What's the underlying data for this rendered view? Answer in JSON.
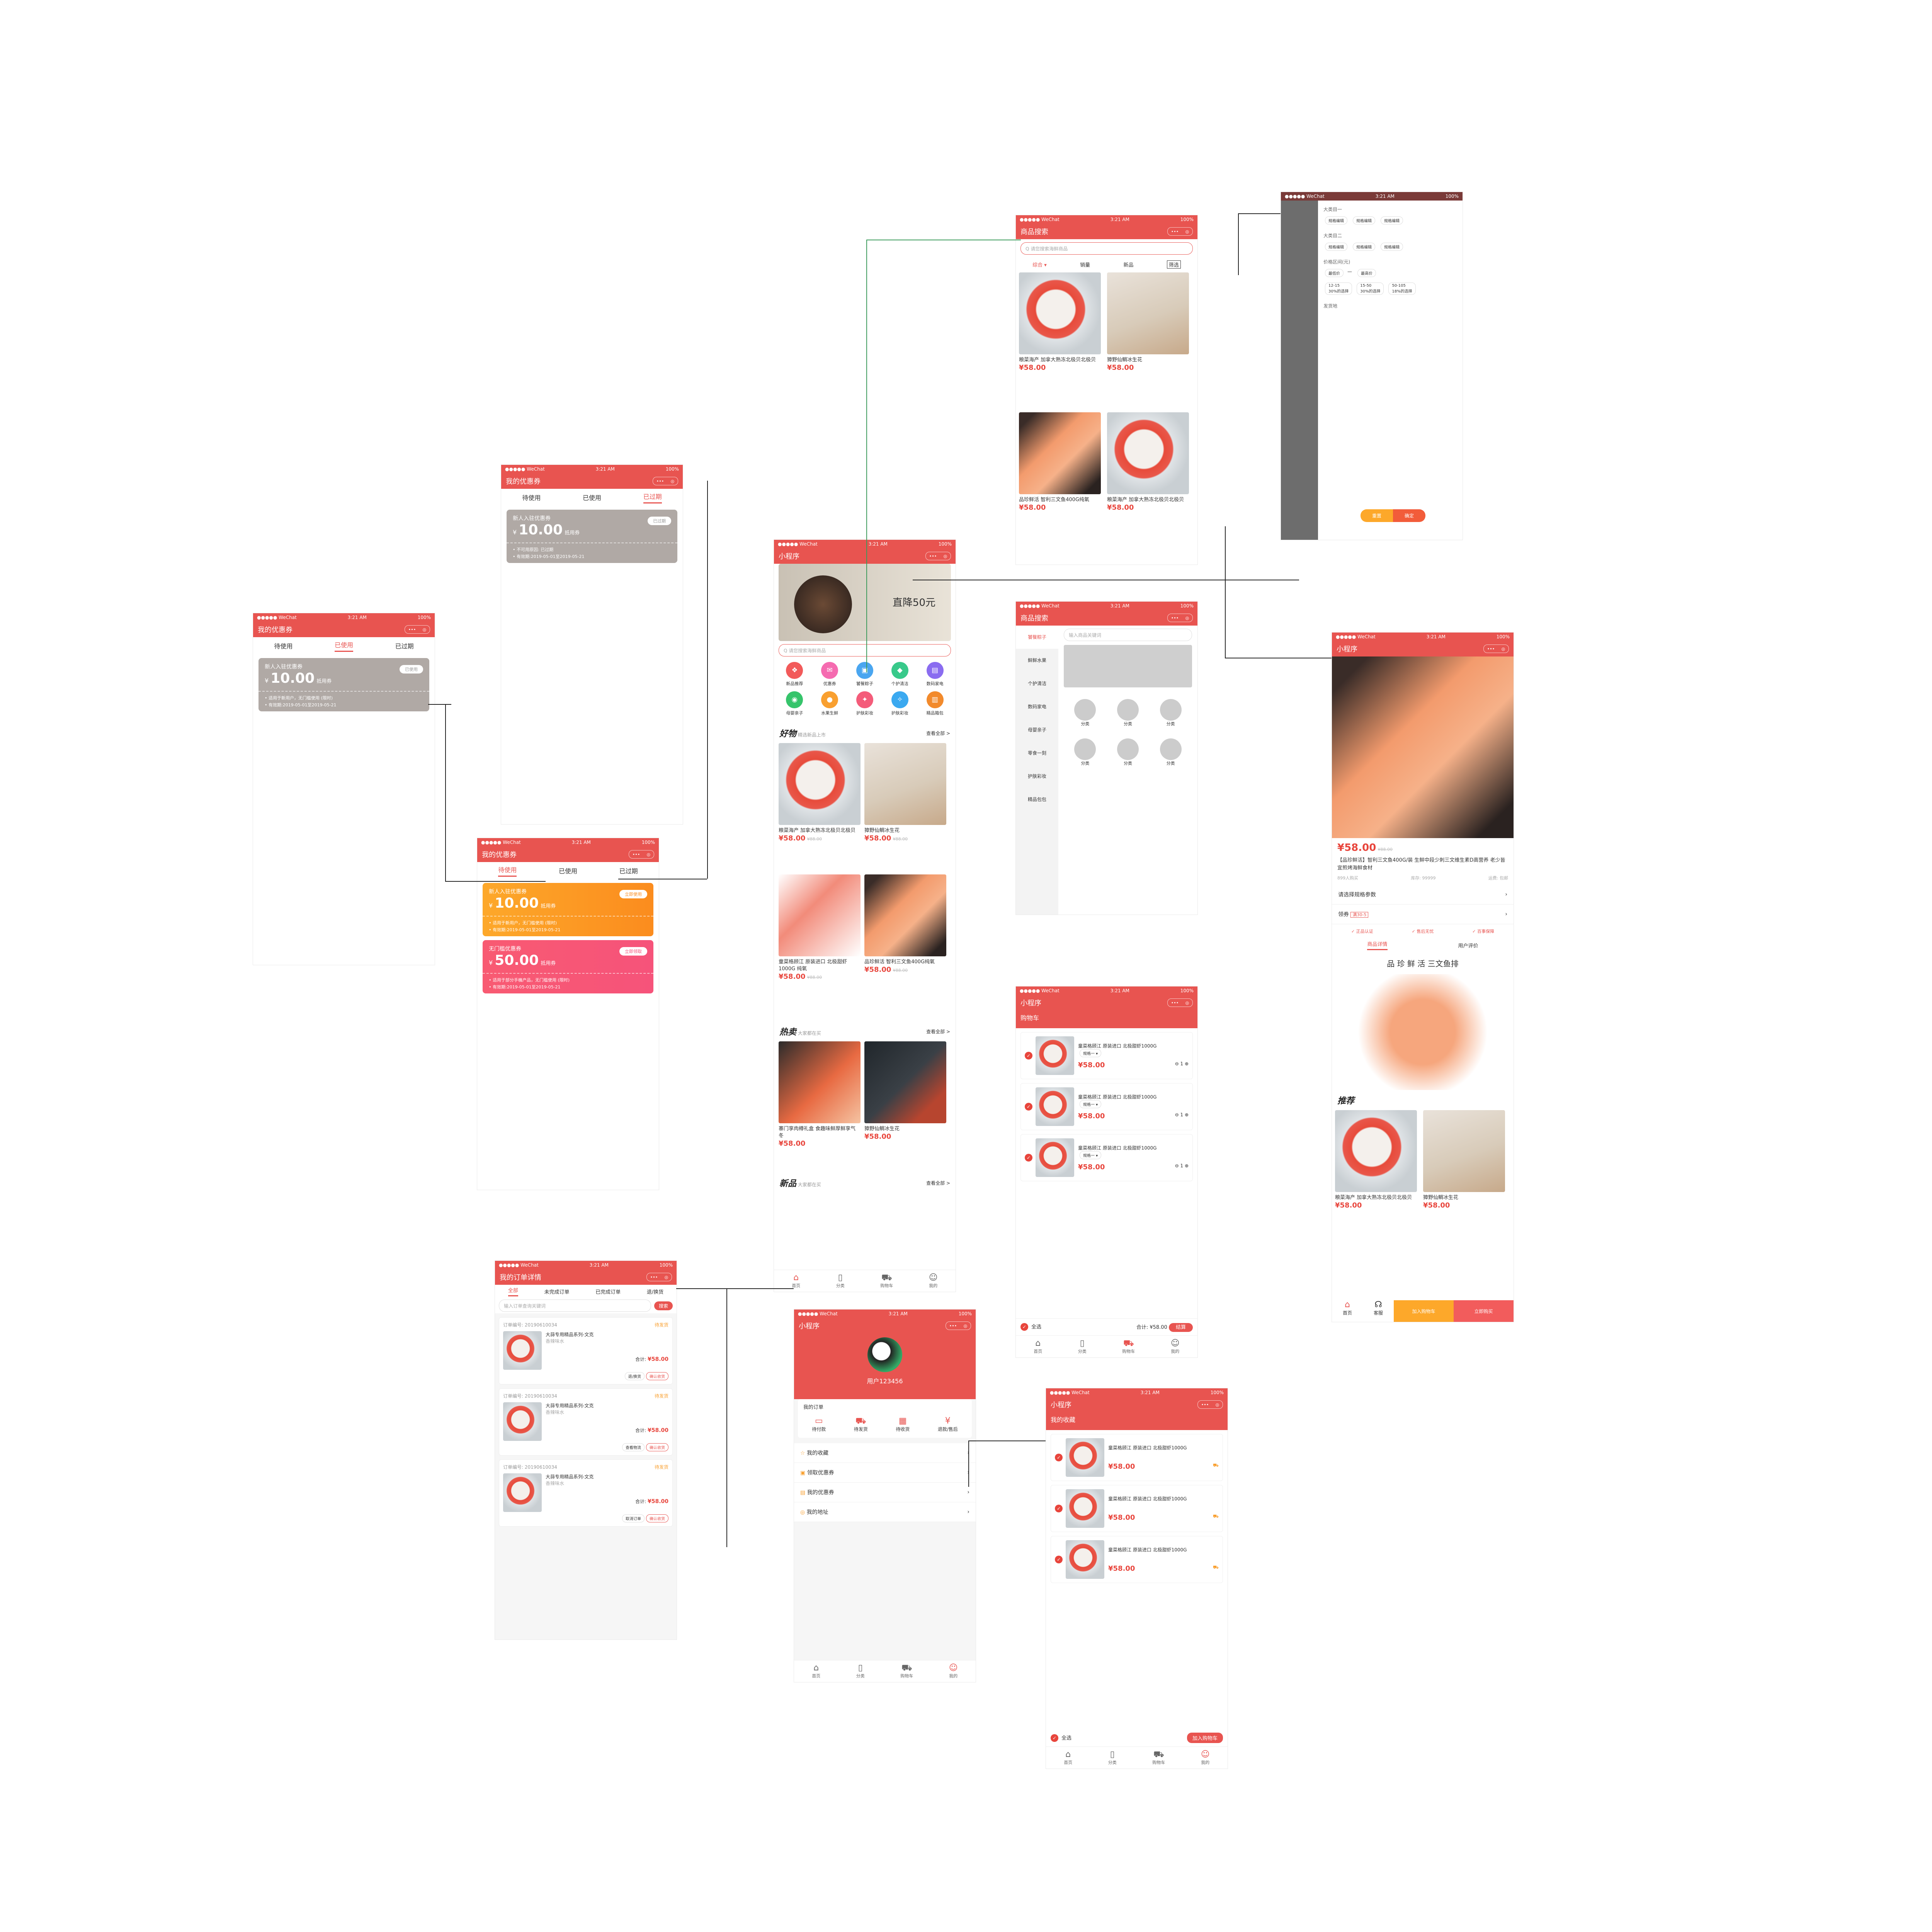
{
  "status": {
    "carrier": "●●●●● WeChat",
    "time": "3:21 AM",
    "battery": "100%"
  },
  "capsule": {
    "dots": "•••",
    "close": "◎"
  },
  "coupon_used": {
    "title": "我的优惠券",
    "tabs": [
      "待使用",
      "已使用",
      "已过期"
    ],
    "name": "新人入驻优惠券",
    "currency": "¥",
    "amount": "10.00",
    "unit": "抵用券",
    "badge": "已使用",
    "rule1": "• 适用于新用户，无门槛使用 (限时)",
    "rule2": "• 有效期:2019-05-01至2019-05-21"
  },
  "coupon_expired": {
    "title": "我的优惠券",
    "tabs": [
      "待使用",
      "已使用",
      "已过期"
    ],
    "name": "新人入驻优惠券",
    "currency": "¥",
    "amount": "10.00",
    "unit": "抵用券",
    "badge": "已过期",
    "rule1": "• 不可用原因: 已过期",
    "rule2": "• 有效期:2019-05-01至2019-05-21"
  },
  "coupon_pending": {
    "title": "我的优惠券",
    "tabs": [
      "待使用",
      "已使用",
      "已过期"
    ],
    "c1": {
      "name": "新人入驻优惠券",
      "currency": "¥",
      "amount": "10.00",
      "unit": "抵用券",
      "badge": "立即使用",
      "rule1": "• 适用于新用户，无门槛使用 (限时)",
      "rule2": "• 有效期:2019-05-01至2019-05-21"
    },
    "c2": {
      "name": "无门槛优惠券",
      "currency": "¥",
      "amount": "50.00",
      "unit": "抵用券",
      "badge": "立即领取",
      "rule1": "• 适用于部分手機产品，无门槛使用 (限时)",
      "rule2": "• 有效期:2019-05-01至2019-05-21"
    }
  },
  "home": {
    "title": "小程序",
    "banner": "直降50元",
    "search_placeholder": "Q 请您搜索海鲜商品",
    "categories": [
      "新品推荐",
      "优惠券",
      "饕餮粽子",
      "个护清洁",
      "数码家电",
      "母婴亲子",
      "水果生鲜",
      "护肤彩妆",
      "护肤彩妆",
      "精品箱包"
    ],
    "section1": {
      "title": "好物",
      "sub": "精选新品上市",
      "more": "查看全部 >"
    },
    "section2": {
      "title": "热卖",
      "sub": "大家都在买",
      "more": "查看全部 >"
    },
    "section3": {
      "title": "新品",
      "sub": "大家都在买",
      "more": "查看全部 >"
    },
    "p1": {
      "name": "粮菜海产 加拿大熟冻北极贝北极贝",
      "price": "¥58.00",
      "old": "¥88.00"
    },
    "p2": {
      "name": "獐野仙鲷冰生花",
      "price": "¥58.00",
      "old": "¥88.00"
    },
    "p3": {
      "name": "童菜格顾江 原装进口 北极甜虾1000G 纯氧",
      "price": "¥58.00",
      "old": "¥88.00"
    },
    "p4": {
      "name": "品珍鲜活 智利三文鱼400G纯氧",
      "price": "¥58.00",
      "old": "¥88.00"
    },
    "p5": {
      "name": "寨门享肉樽礼盒 食趣味鲜厚鲜享气冬",
      "price": "¥58.00",
      "old": "¥88.00"
    },
    "p6": {
      "name": "獐野仙鲷冰生花",
      "price": "¥58.00",
      "old": "¥88.00"
    },
    "tabbar": [
      "首页",
      "分类",
      "购物车",
      "我的"
    ]
  },
  "search": {
    "title": "商品搜索",
    "placeholder": "Q 请您搜索海鲜商品",
    "sort": [
      "综合 ▾",
      "销量",
      "新品",
      "筛选"
    ],
    "p1": {
      "name": "粮菜海产 加拿大熟冻北极贝北极贝",
      "price": "¥58.00"
    },
    "p2": {
      "name": "獐野仙鲷冰生花",
      "price": "¥58.00"
    },
    "p3": {
      "name": "品珍鲜活 智利三文鱼400G纯氧",
      "price": "¥58.00"
    },
    "p4": {
      "name": "粮菜海产 加拿大熟冻北极贝北极贝",
      "price": "¥58.00"
    }
  },
  "filter": {
    "group1": "大类目一",
    "group2": "大类目二",
    "opt": "规格编辑",
    "price_label": "价格区间(元)",
    "low": "最低价",
    "high": "最高价",
    "ranges": [
      "12-15",
      "15-50",
      "50-105"
    ],
    "range_notes": [
      "30%的选择",
      "30%的选择",
      "18%的选择"
    ],
    "more": "发货地",
    "reset": "重置",
    "confirm": "确定"
  },
  "category": {
    "title": "商品搜索",
    "placeholder": "输入商品关键词",
    "menu": [
      "饕餮粽子",
      "鲜鲜水果",
      "个护清洁",
      "数码家电",
      "母婴亲子",
      "零食一刻",
      "护肤彩妆",
      "精品包包"
    ],
    "item": "分类"
  },
  "detail": {
    "title": "小程序",
    "price": "¥58.00",
    "old": "¥88.00",
    "name": "【品珍鲜活】智利三文鱼400G/装 生鲜中段少刺三文维生素D高营养 老少皆宜煎烤海鲜食材",
    "sales": "899人购买",
    "stock": "库存: 99999",
    "ship": "运费: 包邮",
    "spec": "请选择规格参数",
    "coupon_label": "领券",
    "coupon_tag": "满30-5",
    "assure": [
      "✓ 正品认证",
      "✓ 售后无忧",
      "✓ 百事保障"
    ],
    "tabs": [
      "商品详情",
      "用户评价"
    ],
    "banner": "品 珍 鲜 活  三文鱼排",
    "recommend": "推荐",
    "p1": {
      "name": "粮菜海产 加拿大熟冻北极贝北极贝",
      "price": "¥58.00"
    },
    "p2": {
      "name": "獐野仙鲷冰生花",
      "price": "¥58.00"
    },
    "bar": [
      "首页",
      "客服",
      "加入购物车",
      "立即购买"
    ]
  },
  "cart": {
    "title": "小程序",
    "header": "购物车",
    "item": "童菜格顾江 原装进口 北极甜虾1000G",
    "spec": "规格一 ▾",
    "price": "¥58.00",
    "qty": "1",
    "select_all": "全选",
    "total": "合计: ¥58.00",
    "checkout": "结算"
  },
  "mine": {
    "title": "小程序",
    "user": "用户123456",
    "orders_label": "我的订单",
    "order_types": [
      "待付款",
      "待发货",
      "待收货",
      "退款/售后"
    ],
    "rows": [
      "我的收藏",
      "领取优惠券",
      "我的优惠券",
      "我的地址"
    ]
  },
  "fav": {
    "title": "小程序",
    "header": "我的收藏",
    "item": "童菜格顾江 原装进口 北极甜虾1000G",
    "price": "¥58.00",
    "select_all": "全选",
    "add": "加入购物车"
  },
  "orders": {
    "title": "我的订单详情",
    "tabs": [
      "全部",
      "未完成订单",
      "已完成订单",
      "退/换货"
    ],
    "search_placeholder": "输入订单查询关键词",
    "search_btn": "搜索",
    "no": "订单编号: 20190610034",
    "state": "待发货",
    "name": "大蒜专用精品系列-文克",
    "spec": "香辣味水",
    "total_label": "合计:",
    "total": "¥58.00",
    "btns": [
      "退/换货",
      "确认收货",
      "查看物流",
      "取消订单"
    ]
  },
  "colors": {
    "brand": "#e85450",
    "price": "#e8453c",
    "orange": "#fda82a",
    "pink": "#f85a72"
  }
}
